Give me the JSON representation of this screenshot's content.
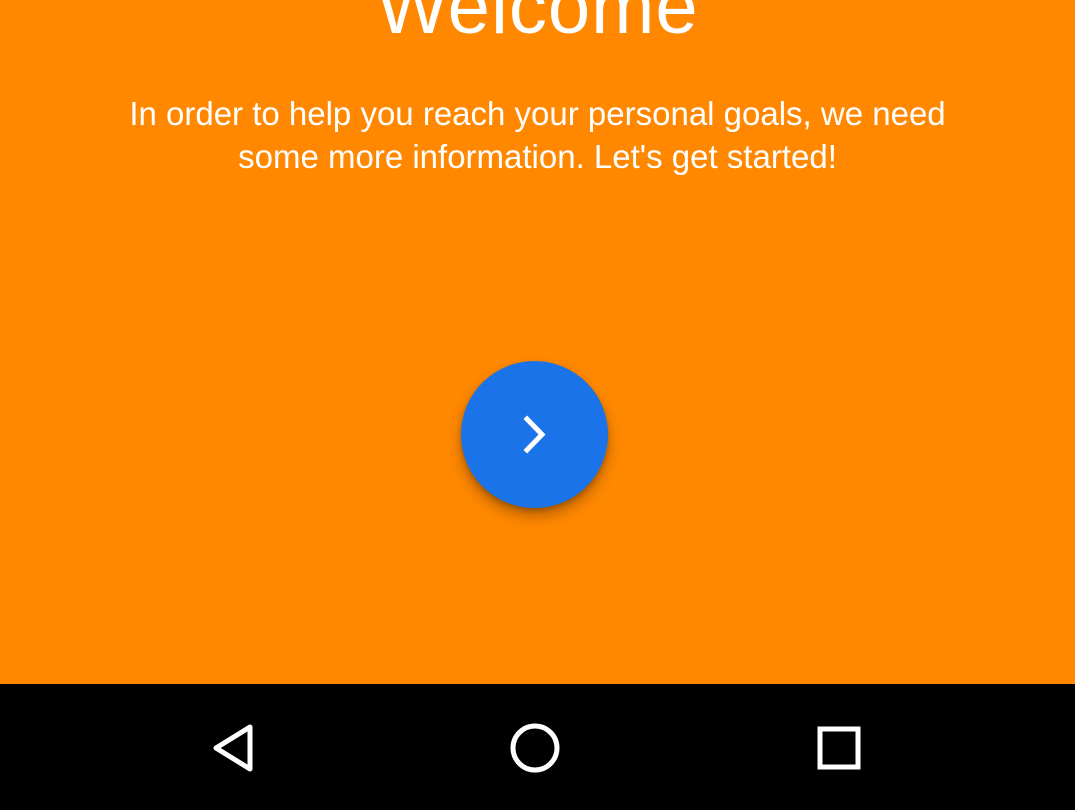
{
  "welcome": {
    "title": "Welcome",
    "message": "In order to help you reach your personal goals, we need some more information. Let's get started!",
    "next_icon": "chevron-right-icon"
  },
  "navbar": {
    "back_icon": "back-triangle-icon",
    "home_icon": "home-circle-icon",
    "recents_icon": "recents-square-icon"
  },
  "colors": {
    "background": "#ff8800",
    "button": "#1a73e8",
    "navbar": "#000000",
    "text": "#ffffff"
  }
}
